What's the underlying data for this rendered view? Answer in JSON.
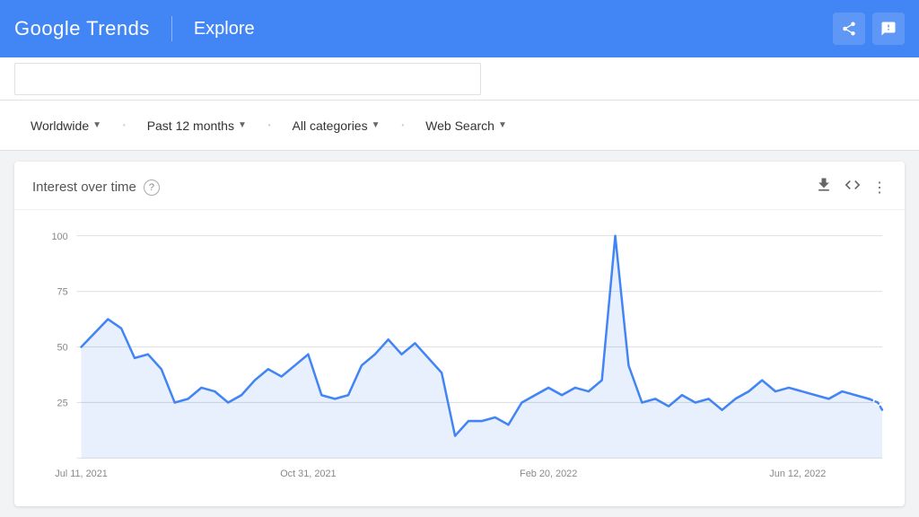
{
  "header": {
    "logo": "Google Trends",
    "page_title": "Explore",
    "share_icon": "share-icon",
    "feedback_icon": "feedback-icon"
  },
  "filters": {
    "worldwide_label": "Worldwide",
    "past12_label": "Past 12 months",
    "categories_label": "All categories",
    "websearch_label": "Web Search"
  },
  "chart": {
    "title": "Interest over time",
    "help_label": "?",
    "download_icon": "download-icon",
    "embed_icon": "code-icon",
    "more_icon": "more-icon",
    "x_labels": [
      "Jul 11, 2021",
      "Oct 31, 2021",
      "Feb 20, 2022",
      "Jun 12, 2022"
    ],
    "y_labels": [
      "100",
      "75",
      "50",
      "25"
    ],
    "line_color": "#4285f4"
  }
}
